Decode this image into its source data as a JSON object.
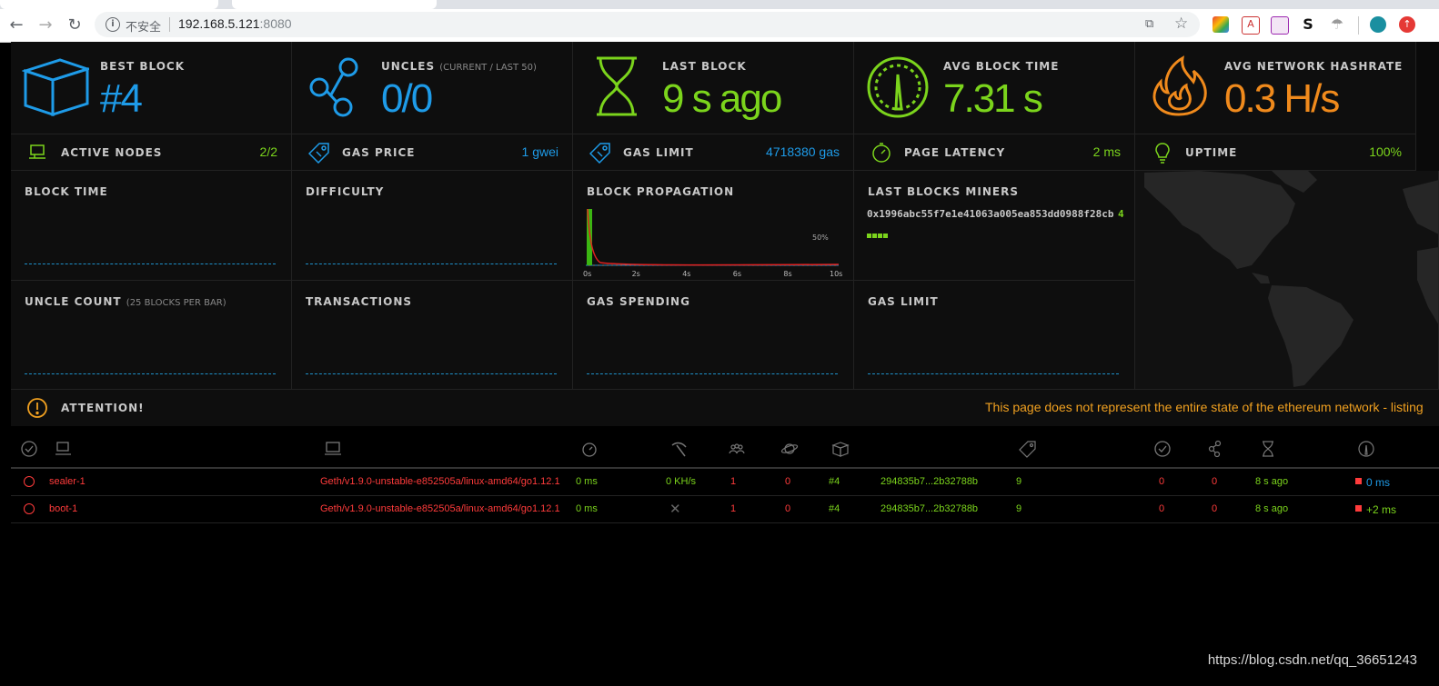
{
  "browser": {
    "insecure_label": "不安全",
    "url_host": "192.168.5.121",
    "url_port": ":8080"
  },
  "stats": [
    {
      "label": "BEST BLOCK",
      "sub": "",
      "value": "#4",
      "color": "#1e9be8",
      "icon": "cube-icon"
    },
    {
      "label": "UNCLES",
      "sub": "(CURRENT / LAST 50)",
      "value": "0/0",
      "color": "#1e9be8",
      "icon": "uncles-icon"
    },
    {
      "label": "LAST BLOCK",
      "sub": "",
      "value": "9 s ago",
      "color": "#7bd41c",
      "icon": "hourglass-icon"
    },
    {
      "label": "AVG BLOCK TIME",
      "sub": "",
      "value": "7.31 s",
      "color": "#7bd41c",
      "icon": "gauge-icon"
    },
    {
      "label": "AVG NETWORK HASHRATE",
      "sub": "",
      "value": "0.3 H/s",
      "color": "#f08a1c",
      "icon": "fire-icon"
    }
  ],
  "info_rows": [
    {
      "label": "ACTIVE NODES",
      "value": "2/2",
      "color": "#7bd41c",
      "icon": "laptop-icon"
    },
    {
      "label": "GAS PRICE",
      "value": "1 gwei",
      "color": "#1e9be8",
      "icon": "tag-icon"
    },
    {
      "label": "GAS LIMIT",
      "value": "4718380 gas",
      "color": "#1e9be8",
      "icon": "tag-icon"
    },
    {
      "label": "PAGE LATENCY",
      "value": "2 ms",
      "color": "#7bd41c",
      "icon": "timer-icon"
    },
    {
      "label": "UPTIME",
      "value": "100%",
      "color": "#7bd41c",
      "icon": "bulb-icon"
    }
  ],
  "charts": {
    "block_time": "BLOCK TIME",
    "difficulty": "DIFFICULTY",
    "block_propagation": "BLOCK PROPAGATION",
    "last_blocks_miners": "LAST BLOCKS MINERS",
    "uncle_count": "UNCLE COUNT",
    "uncle_count_sub": "(25 BLOCKS PER BAR)",
    "transactions": "TRANSACTIONS",
    "gas_spending": "GAS SPENDING",
    "gas_limit": "GAS LIMIT",
    "miner_address": "0x1996abc55f7e1e41063a005ea853dd0988f28cb",
    "miner_count": "4"
  },
  "propagation": {
    "ticks": [
      "0s",
      "2s",
      "4s",
      "6s",
      "8s",
      "10s"
    ],
    "pct_label": "50%"
  },
  "attention": {
    "label": "ATTENTION!",
    "message": "This page does not represent the entire state of the ethereum network - listing"
  },
  "nodes": [
    {
      "name": "sealer-1",
      "client": "Geth/v1.9.0-unstable-e852505a/linux-amd64/go1.12.1",
      "latency": "0 ms",
      "hashrate": "0 KH/s",
      "mining": true,
      "peers": "1",
      "pending": "0",
      "block": "#4",
      "hash": "294835b7...2b32788b",
      "difficulty": "9",
      "block_tx": "0",
      "uncles": "0",
      "last_block": "8 s ago",
      "prop": "0 ms",
      "prop_color": "#1e9be8"
    },
    {
      "name": "boot-1",
      "client": "Geth/v1.9.0-unstable-e852505a/linux-amd64/go1.12.1",
      "latency": "0 ms",
      "hashrate": "",
      "mining": false,
      "peers": "1",
      "pending": "0",
      "block": "#4",
      "hash": "294835b7...2b32788b",
      "difficulty": "9",
      "block_tx": "0",
      "uncles": "0",
      "last_block": "8 s ago",
      "prop": "+2 ms",
      "prop_color": "#7bd41c"
    }
  ],
  "watermark": "https://blog.csdn.net/qq_36651243"
}
